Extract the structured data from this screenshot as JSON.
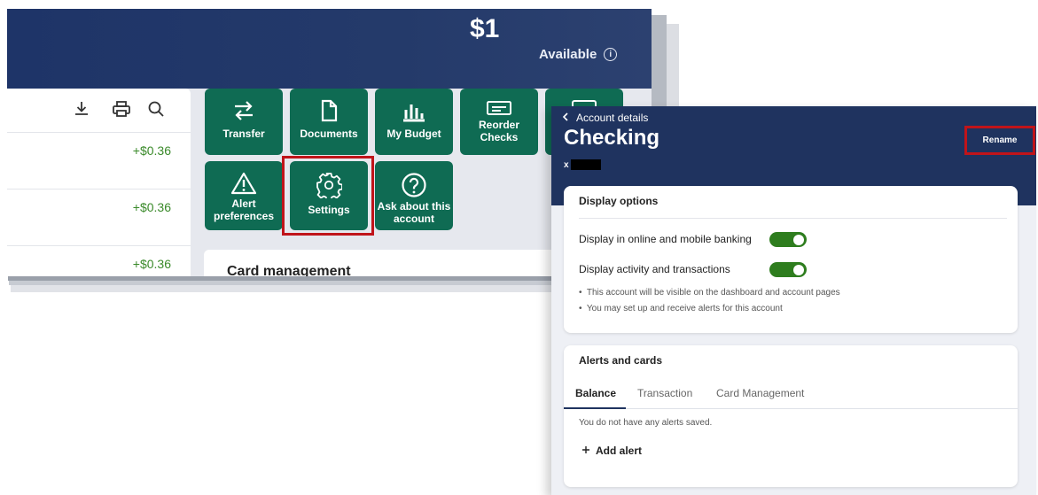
{
  "left": {
    "balance": "$1",
    "available_label": "Available",
    "transactions": [
      {
        "amount": "+$0.36"
      },
      {
        "amount": "+$0.36"
      },
      {
        "amount": "+$0.36"
      }
    ],
    "actions": {
      "transfer": "Transfer",
      "documents": "Documents",
      "budget": "My Budget",
      "reorder_line1": "Reorder",
      "reorder_line2": "Checks",
      "alert_line1": "Alert",
      "alert_line2": "preferences",
      "settings": "Settings",
      "ask_line1": "Ask about this",
      "ask_line2": "account"
    },
    "card_management_title": "Card management"
  },
  "right": {
    "back_label": "Account details",
    "account_title": "Checking",
    "account_prefix": "x",
    "rename_label": "Rename",
    "display_options": {
      "title": "Display options",
      "option_online": "Display in online and mobile banking",
      "option_activity": "Display activity and transactions",
      "online_enabled": true,
      "activity_enabled": true,
      "notes": [
        "This account will be visible on the dashboard and account pages",
        "You may set up and receive alerts for this account"
      ]
    },
    "alerts_cards": {
      "title": "Alerts and cards",
      "tabs": [
        "Balance",
        "Transaction",
        "Card Management"
      ],
      "active_tab": "Balance",
      "empty_message": "You do not have any alerts saved.",
      "add_alert": "Add alert"
    }
  },
  "colors": {
    "header_navy": "#1f335f",
    "tile_green": "#0f6b53",
    "highlight_red": "#c0141a",
    "amount_green": "#3a8a2a",
    "toggle_green": "#2e7d1e"
  }
}
